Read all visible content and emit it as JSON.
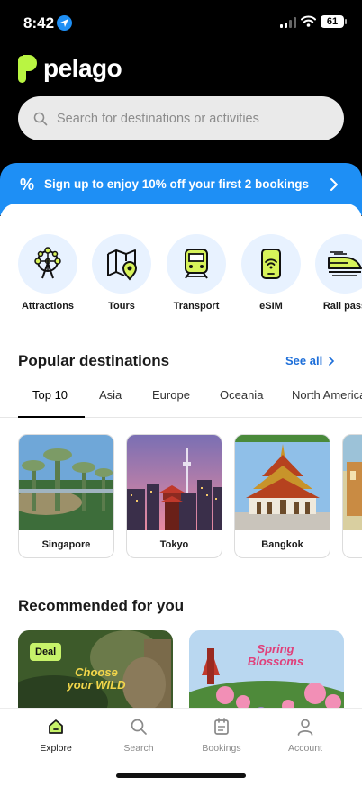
{
  "status": {
    "time": "8:42",
    "battery": "61"
  },
  "brand": {
    "name": "pelago"
  },
  "search": {
    "placeholder": "Search for destinations or activities"
  },
  "promo": {
    "icon": "%",
    "text": "Sign up to enjoy 10% off your first 2 bookings"
  },
  "categories": [
    {
      "label": "Attractions",
      "icon": "ferris-wheel-icon"
    },
    {
      "label": "Tours",
      "icon": "map-pin-icon"
    },
    {
      "label": "Transport",
      "icon": "train-icon"
    },
    {
      "label": "eSIM",
      "icon": "esim-phone-icon"
    },
    {
      "label": "Rail pass",
      "icon": "bullet-train-icon"
    }
  ],
  "popular": {
    "title": "Popular destinations",
    "see_all": "See all",
    "tabs": [
      "Top 10",
      "Asia",
      "Europe",
      "Oceania",
      "North America"
    ],
    "active_tab": "Top 10",
    "destinations": [
      {
        "name": "Singapore"
      },
      {
        "name": "Tokyo"
      },
      {
        "name": "Bangkok"
      }
    ]
  },
  "recommended": {
    "title": "Recommended for you",
    "cards": [
      {
        "badge": "Deal",
        "headline": "Choose your WILD"
      },
      {
        "headline": "Spring Blossoms"
      }
    ]
  },
  "nav": [
    {
      "label": "Explore",
      "icon": "home-icon",
      "active": true
    },
    {
      "label": "Search",
      "icon": "search-icon"
    },
    {
      "label": "Bookings",
      "icon": "bookings-icon"
    },
    {
      "label": "Account",
      "icon": "account-icon"
    }
  ],
  "colors": {
    "accent": "#1e8ff5",
    "brand_green": "#b9f542",
    "deal": "#c7f26a"
  }
}
